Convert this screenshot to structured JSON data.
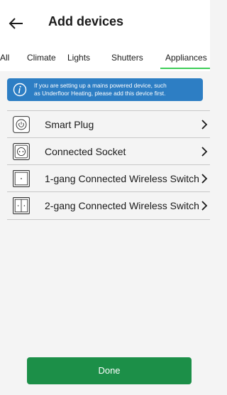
{
  "header": {
    "back_icon": "back-arrow-icon",
    "title": "Add devices"
  },
  "tabs": [
    {
      "label": "All",
      "selected": false
    },
    {
      "label": "Climate",
      "selected": false
    },
    {
      "label": "Lights",
      "selected": false
    },
    {
      "label": "Shutters",
      "selected": false
    },
    {
      "label": "Appliances",
      "selected": true
    }
  ],
  "info": {
    "icon": "info-icon",
    "line1": "If you are setting up a mains powered device, such",
    "line2": "as Underfloor Heating, please add this device first."
  },
  "devices": [
    {
      "label": "Smart Plug",
      "icon": "smart-plug-icon"
    },
    {
      "label": "Connected Socket",
      "icon": "socket-icon"
    },
    {
      "label": "1-gang Connected Wireless Switch",
      "icon": "one-gang-switch-icon"
    },
    {
      "label": "2-gang Connected Wireless Switch",
      "icon": "two-gang-switch-icon"
    }
  ],
  "done_label": "Done",
  "colors": {
    "accent_green": "#3dcd58",
    "button_green": "#1c8f48",
    "info_blue": "#2d7ec4"
  }
}
